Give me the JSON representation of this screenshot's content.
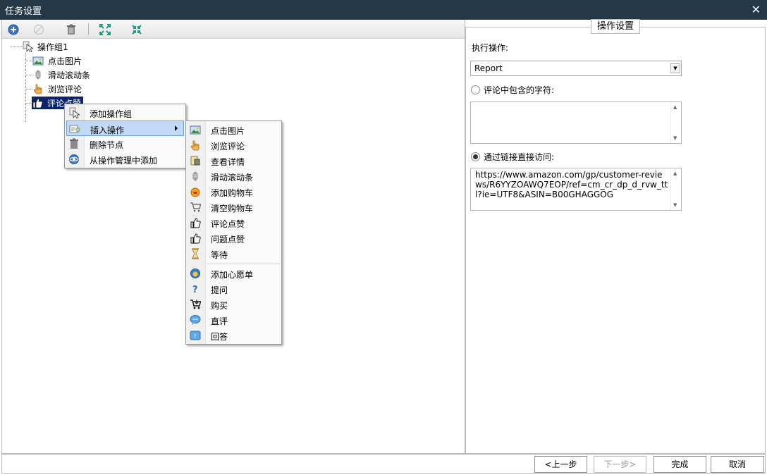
{
  "window": {
    "title": "任务设置",
    "close_glyph": "✕"
  },
  "toolbar": {
    "buttons": [
      {
        "name": "add-icon"
      },
      {
        "name": "disable-icon"
      },
      {
        "name": "trash-icon"
      },
      {
        "name": "expand-icon"
      },
      {
        "name": "collapse-icon"
      }
    ]
  },
  "tree": {
    "root": {
      "label": "操作组1",
      "icon": "cursor-group-icon"
    },
    "items": [
      {
        "label": "点击图片",
        "icon": "image-icon"
      },
      {
        "label": "滑动滚动条",
        "icon": "scroll-icon"
      },
      {
        "label": "浏览评论",
        "icon": "hand-pointer-icon"
      },
      {
        "label": "评论点赞",
        "icon": "thumbs-up-icon",
        "selected": true
      }
    ]
  },
  "context_menu": {
    "items": [
      {
        "label": "添加操作组",
        "icon": "cursor-group-icon"
      },
      {
        "label": "插入操作",
        "icon": "insert-icon",
        "has_submenu": true,
        "highlighted": true
      },
      {
        "label": "删除节点",
        "icon": "trash-icon"
      },
      {
        "label": "从操作管理中添加",
        "icon": "manager-icon"
      }
    ]
  },
  "submenu": {
    "items": [
      {
        "label": "点击图片",
        "icon": "image-icon"
      },
      {
        "label": "浏览评论",
        "icon": "hand-pointer-icon"
      },
      {
        "label": "查看详情",
        "icon": "details-icon"
      },
      {
        "label": "滑动滚动条",
        "icon": "scroll-icon"
      },
      {
        "label": "添加购物车",
        "icon": "add-cart-icon"
      },
      {
        "label": "清空购物车",
        "icon": "empty-cart-icon"
      },
      {
        "label": "评论点赞",
        "icon": "thumbs-up-icon"
      },
      {
        "label": "问题点赞",
        "icon": "thumbs-up-icon"
      },
      {
        "label": "等待",
        "icon": "hourglass-icon"
      },
      {
        "label": "添加心愿单",
        "icon": "wishlist-icon"
      },
      {
        "label": "提问",
        "icon": "question-icon"
      },
      {
        "label": "购买",
        "icon": "buy-cart-icon"
      },
      {
        "label": "直评",
        "icon": "comment-bubble-icon"
      },
      {
        "label": "回答",
        "icon": "answer-icon"
      }
    ]
  },
  "settings": {
    "legend": "操作设置",
    "exec_label": "执行操作:",
    "exec_value": "Report",
    "option_contains_label": "评论中包含的字符:",
    "option_contains_checked": false,
    "option_contains_value": "",
    "option_link_label": "通过链接直接访问:",
    "option_link_checked": true,
    "option_link_value": "https://www.amazon.com/gp/customer-reviews/R6YYZOAWQ7EOP/ref=cm_cr_dp_d_rvw_ttl?ie=UTF8&ASIN=B00GHAGGOG"
  },
  "footer": {
    "prev": "<上一步",
    "next": "下一步>",
    "next_disabled": true,
    "finish": "完成",
    "cancel": "取消"
  },
  "colors": {
    "titlebar": "#253848",
    "selection": "#0a246a",
    "menu_highlight": "#c1d9f4"
  }
}
